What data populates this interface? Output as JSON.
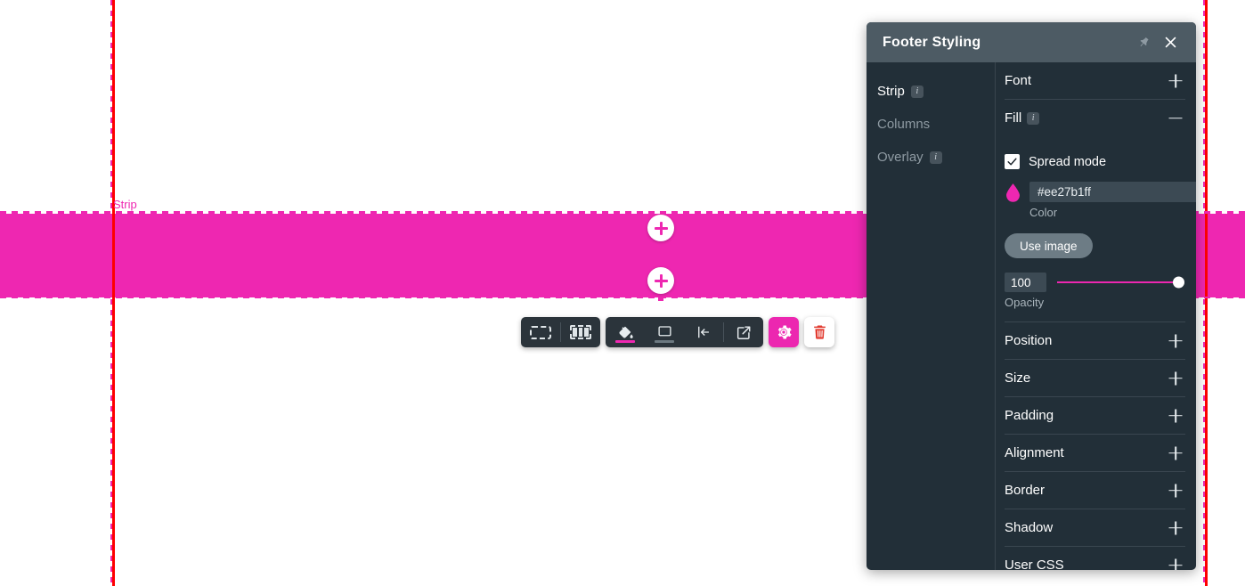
{
  "canvas": {
    "strip_label": "Strip",
    "add_button_label": "+",
    "strip_color": "#ee27b1",
    "guide_color": "#fe0000"
  },
  "toolbar": {
    "items": [
      {
        "name": "select-strip",
        "icon": "dashed-rectangle-icon"
      },
      {
        "name": "select-columns",
        "icon": "columns-icon"
      },
      {
        "name": "fill-color",
        "icon": "paint-bucket-icon",
        "underline": "#ee27b1"
      },
      {
        "name": "background",
        "icon": "frame-icon",
        "underline": "#6b7880"
      },
      {
        "name": "align-left",
        "icon": "align-left-icon"
      },
      {
        "name": "open-external",
        "icon": "external-link-icon"
      }
    ],
    "settings_icon": "gear-icon",
    "delete_icon": "trash-icon",
    "settings_color": "#ec27b0",
    "delete_color": "#e23b30"
  },
  "panel": {
    "title": "Footer Styling",
    "pin_icon": "pin-icon",
    "close_icon": "close-icon",
    "nav": [
      {
        "label": "Strip",
        "active": true,
        "info": true
      },
      {
        "label": "Columns",
        "active": false,
        "info": false
      },
      {
        "label": "Overlay",
        "active": false,
        "info": true
      }
    ],
    "sections": [
      {
        "label": "Font",
        "expanded": false
      },
      {
        "label": "Fill",
        "expanded": true,
        "info": true
      },
      {
        "label": "Position",
        "expanded": false
      },
      {
        "label": "Size",
        "expanded": false
      },
      {
        "label": "Padding",
        "expanded": false
      },
      {
        "label": "Alignment",
        "expanded": false
      },
      {
        "label": "Border",
        "expanded": false
      },
      {
        "label": "Shadow",
        "expanded": false
      },
      {
        "label": "User CSS",
        "expanded": false
      }
    ],
    "fill": {
      "spread_mode_label": "Spread mode",
      "spread_mode_checked": true,
      "color_value": "#ee27b1ff",
      "color_label": "Color",
      "color_swatch": "#ee27b1",
      "use_image_label": "Use image",
      "opacity_value": "100",
      "opacity_label": "Opacity",
      "opacity_percent": 100
    }
  }
}
